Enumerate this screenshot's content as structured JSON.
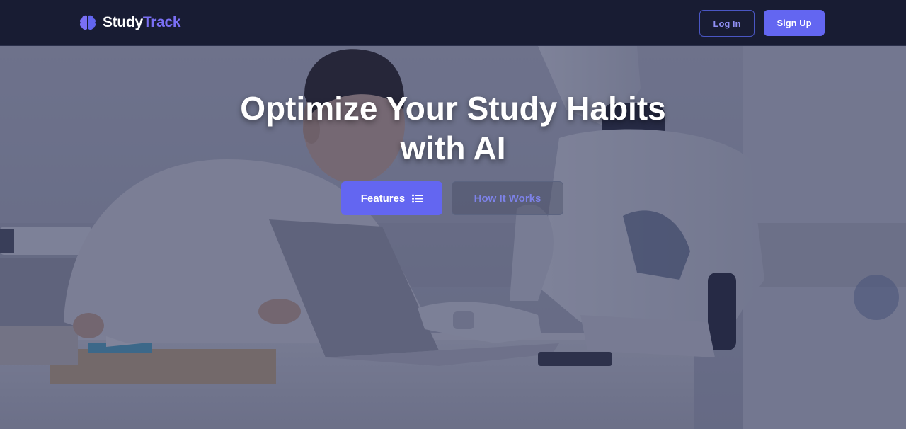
{
  "brand": {
    "name_part1": "Study",
    "name_part2": "Track",
    "icon": "brain-icon"
  },
  "nav": {
    "login_label": "Log In",
    "signup_label": "Sign Up"
  },
  "hero": {
    "title_line1": "Optimize Your Study Habits",
    "title_line2": "with AI",
    "features_label": "Features",
    "features_icon": "list-icon",
    "how_label": "How It Works"
  },
  "colors": {
    "accent": "#6366f1",
    "nav_bg": "#181c33",
    "brand_accent": "#7a6ff4"
  }
}
